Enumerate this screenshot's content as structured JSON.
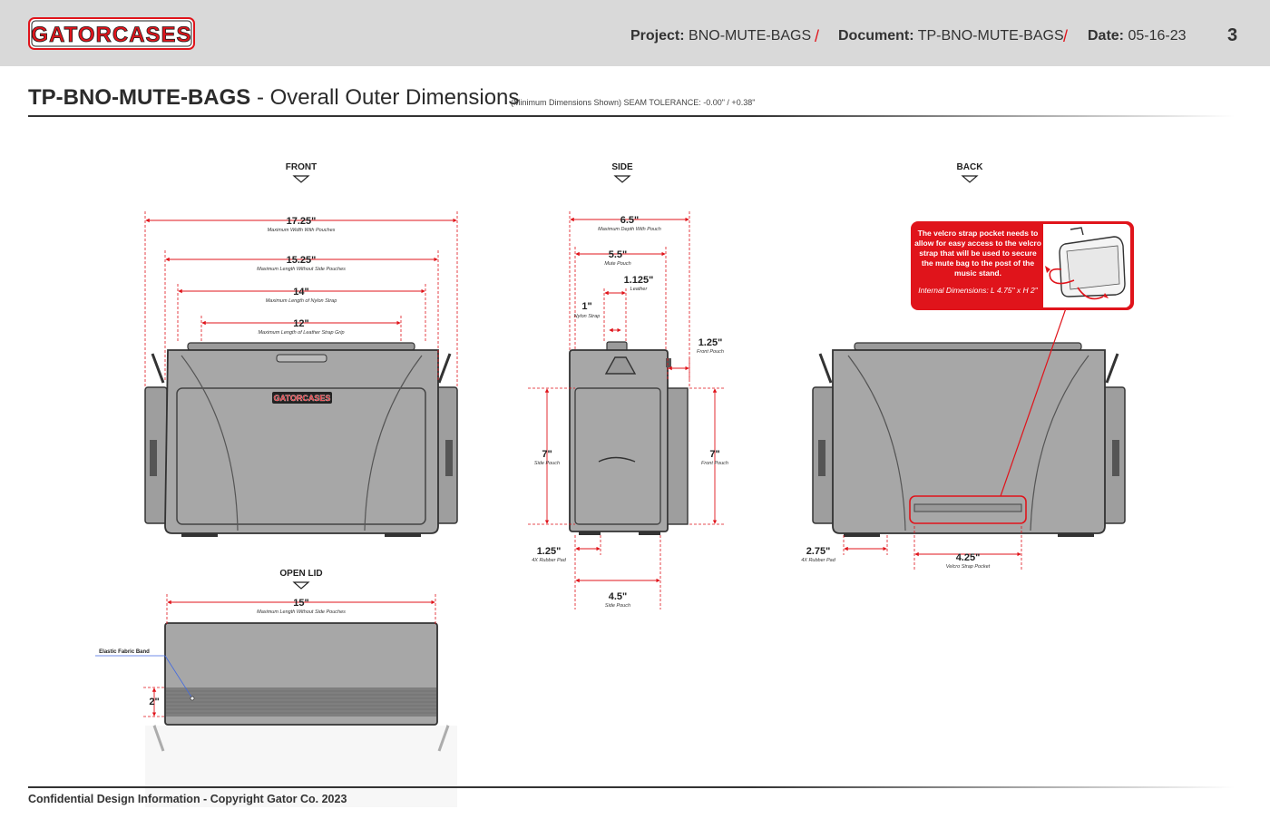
{
  "header": {
    "logo_text": "GATORCASES",
    "project_label": "Project:",
    "project_value": "BNO-MUTE-BAGS",
    "document_label": "Document:",
    "document_value": "TP-BNO-MUTE-BAGS",
    "date_label": "Date:",
    "date_value": "05-16-23",
    "separator": "/",
    "page_number": "3"
  },
  "title": {
    "bold": "TP-BNO-MUTE-BAGS",
    "rest": " - Overall Outer Dimensions",
    "note": "(Minimum Dimensions Shown) SEAM TOLERANCE: -0.00\" / +0.38\""
  },
  "views": {
    "front": "FRONT",
    "side": "SIDE",
    "back": "BACK",
    "open_lid": "OPEN LID"
  },
  "front_dims": [
    {
      "value": "17.25\"",
      "caption": "Maximum Width With Pouches"
    },
    {
      "value": "15.25\"",
      "caption": "Maximum Length Without Side Pouches"
    },
    {
      "value": "14\"",
      "caption": "Maximum Length of Nylon Strap"
    },
    {
      "value": "12\"",
      "caption": "Maximum Length of Leather Strap Grip"
    }
  ],
  "side_dims": {
    "depth": {
      "value": "6.5\"",
      "caption": "Maximum Depth With Pouch"
    },
    "mute_pouch": {
      "value": "5.5\"",
      "caption": "Mute Pouch"
    },
    "leather": {
      "value": "1.125\"",
      "caption": "Leather"
    },
    "nylon": {
      "value": "1\"",
      "caption": "Nylon Strap"
    },
    "front_pouch": {
      "value": "1.25\"",
      "caption": "Front Pouch"
    },
    "side_pouch_h": {
      "value": "7\"",
      "caption": "Side Pouch"
    },
    "front_pouch_h": {
      "value": "7\"",
      "caption": "Front Pouch"
    },
    "rubber_pad": {
      "value": "1.25\"",
      "caption": "4X Rubber Pad"
    },
    "side_pouch_w": {
      "value": "4.5\"",
      "caption": "Side Pouch"
    }
  },
  "back_dims": {
    "rubber_pad": {
      "value": "2.75\"",
      "caption": "4X Rubber Pad"
    },
    "velcro": {
      "value": "4.25\"",
      "caption": "Velcro Strap Pocket"
    }
  },
  "callout": {
    "text": "The velcro strap pocket needs to allow for easy access to the velcro strap that will be used to secure the mute bag to the post of the music stand.",
    "sub": "Internal Dimensions: L 4.75\" x H 2\""
  },
  "open_lid_dims": {
    "width": {
      "value": "15\"",
      "caption": "Maximum Length Without Side Pouches"
    },
    "band_height": {
      "value": "2\""
    },
    "band_label": "Elastic Fabric Band"
  },
  "footer": "Confidential Design Information - Copyright Gator Co. 2023",
  "colors": {
    "accent": "#e0141b",
    "bag": "#a7a7a7",
    "bar": "#d9d9d9"
  }
}
